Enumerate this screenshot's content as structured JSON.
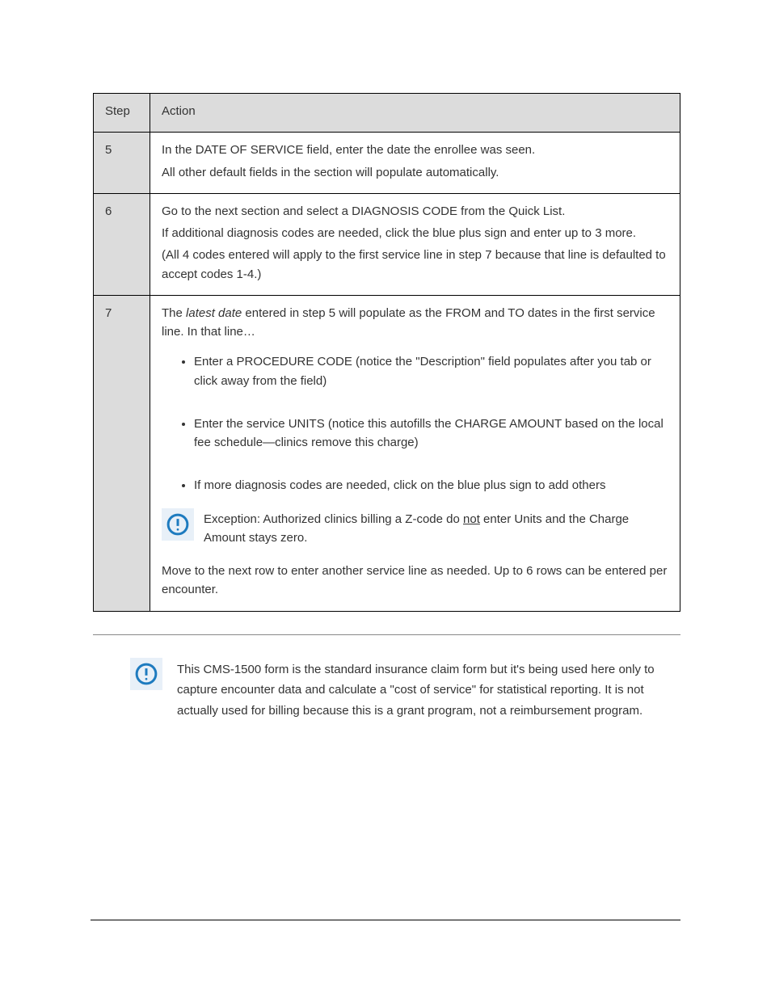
{
  "table": {
    "header": {
      "step": "Step",
      "action": "Action"
    },
    "rows": [
      {
        "step": "5",
        "lines": [
          "In the DATE OF SERVICE field, enter the date the enrollee was seen.",
          "All other default fields in the section will populate automatically."
        ]
      },
      {
        "step": "6",
        "lines": [
          "Go to the next section and select a DIAGNOSIS CODE from the Quick List.",
          "If additional diagnosis codes are needed, click the blue plus sign and enter up to 3 more.",
          "(All 4 codes entered will apply to the first service line in step 7 because that line is defaulted to accept codes 1-4.)"
        ]
      },
      {
        "step": "7",
        "plain_prefix": "The ",
        "italic": "latest date",
        "plain_after_italic": " entered in step 5 will populate as the FROM and TO dates in the first service line. In that line…",
        "bullets": [
          "Enter a PROCEDURE CODE (notice the \"Description\" field populates after you tab or click away from the field)",
          "Enter the service UNITS (notice this autofills the CHARGE AMOUNT based on the local fee schedule—clinics remove this charge)",
          "If more diagnosis codes are needed, click on the blue plus sign to add others"
        ],
        "note_prefix": "Exception: Authorized clinics billing a Z-code do ",
        "note_underline": "not",
        "note_suffix": " enter Units and the Charge Amount stays zero.",
        "trailing": "Move to the next row to enter another service line as needed. Up to 6 rows can be entered per encounter."
      }
    ]
  },
  "below_note": "This CMS-1500 form is the standard insurance claim form but it's being used here only to capture encounter data and calculate a \"cost of service\" for statistical reporting. It is not actually used for billing because this is a grant program, not a reimbursement program.",
  "icon_name": "alert-circle-icon"
}
